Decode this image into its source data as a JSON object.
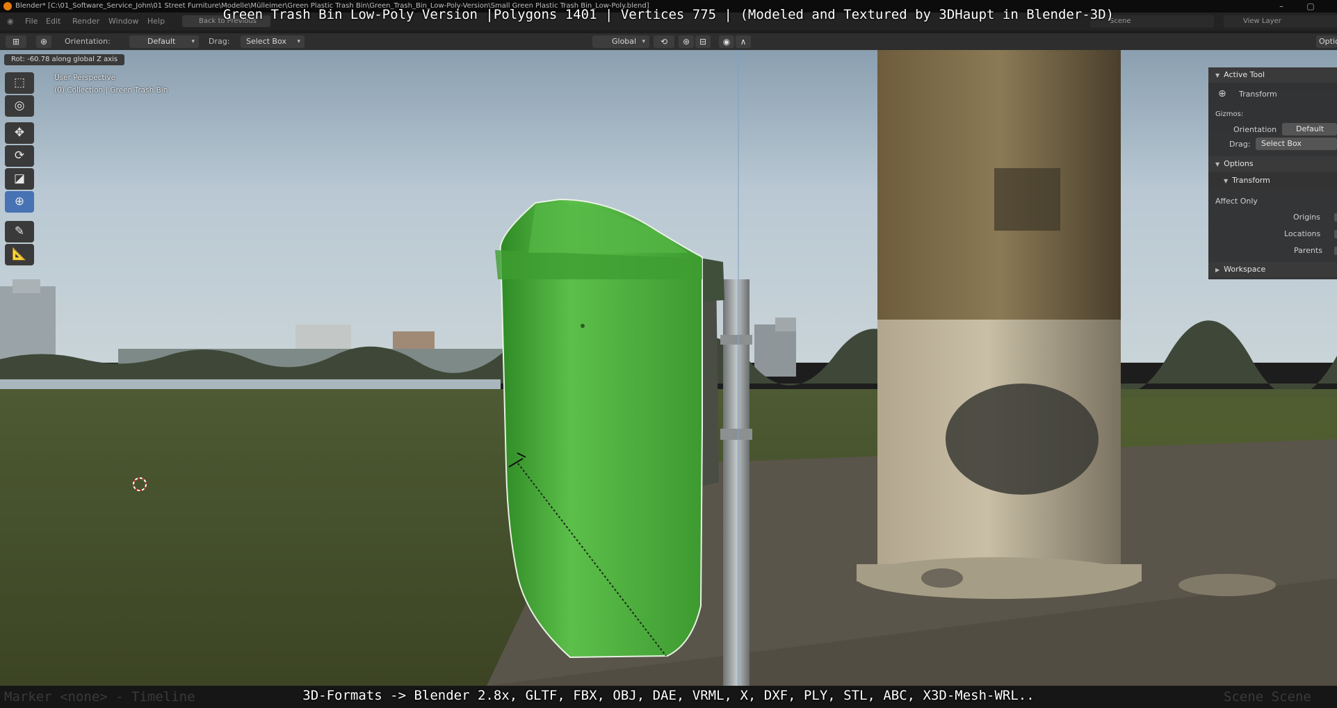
{
  "window": {
    "title": "Blender* [C:\\01_Software_Service_John\\01 Street Furniture\\Modelle\\Mülleimer\\Green Plastic Trash Bin\\Green_Trash_Bin_Low-Poly-Version\\Small Green Plastic Trash Bin_Low-Poly.blend]",
    "minimize": "–",
    "maximize": "▢",
    "close": "✕"
  },
  "menu": {
    "items": [
      "File",
      "Edit",
      "Render",
      "Window",
      "Help"
    ],
    "back_button": "Back to Previous",
    "scene_label": "Scene",
    "view_layer_label": "View Layer"
  },
  "caption_top": "Green Trash Bin Low-Poly Version |Polygons 1401 | Vertices 775 | (Modeled and Textured by 3DHaupt in Blender-3D)",
  "caption_bottom": "3D-Formats -> Blender 2.8x, GLTF, FBX, OBJ, DAE, VRML, X, DXF, PLY, STL, ABC, X3D-Mesh-WRL..",
  "header": {
    "orientation_label": "Orientation:",
    "orientation_value": "Default",
    "drag_label": "Drag:",
    "drag_value": "Select Box",
    "transform_orientation": "Global",
    "options_label": "Optio"
  },
  "viewport": {
    "operator_info": "Rot: -60.78 along global Z axis",
    "perspective": "User Perspective",
    "collection": "(0) Collection | Green Trash Bin"
  },
  "tools": [
    {
      "name": "select-box-tool",
      "icon": "⬚"
    },
    {
      "name": "cursor-tool",
      "icon": "◎"
    },
    {
      "name": "move-tool",
      "icon": "✥"
    },
    {
      "name": "rotate-tool",
      "icon": "⟳"
    },
    {
      "name": "scale-tool",
      "icon": "◪"
    },
    {
      "name": "transform-tool",
      "icon": "⊕"
    },
    {
      "name": "annotate-tool",
      "icon": "✎"
    },
    {
      "name": "measure-tool",
      "icon": "📐"
    }
  ],
  "npanel": {
    "active_tool_header": "Active Tool",
    "active_tool_name": "Transform",
    "gizmos_label": "Gizmos:",
    "orientation_label": "Orientation",
    "orientation_value": "Default",
    "drag_label": "Drag:",
    "drag_value": "Select Box",
    "options_header": "Options",
    "transform_sub": "Transform",
    "affect_only": "Affect Only",
    "origins": "Origins",
    "locations": "Locations",
    "parents": "Parents",
    "workspace_header": "Workspace"
  },
  "statusbar": {
    "ghost_left": "Marker <none> - Timeline",
    "ghost_right": "Scene Scene"
  },
  "colors": {
    "active_blue": "#4772b3",
    "bin_green": "#4caf3f",
    "sky": "#b8c8d4"
  }
}
